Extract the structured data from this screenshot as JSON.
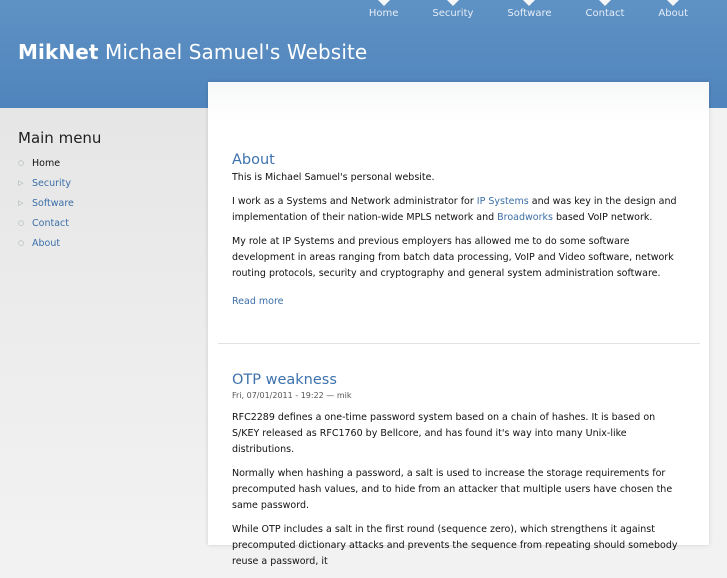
{
  "nav": [
    "Home",
    "Security",
    "Software",
    "Contact",
    "About"
  ],
  "site": {
    "name": "MikNet",
    "tagline": "Michael Samuel's Website"
  },
  "sidebar": {
    "title": "Main menu",
    "items": [
      {
        "label": "Home",
        "active": true
      },
      {
        "label": "Security",
        "active": false
      },
      {
        "label": "Software",
        "active": false
      },
      {
        "label": "Contact",
        "active": false
      },
      {
        "label": "About",
        "active": false
      }
    ]
  },
  "about": {
    "title": "About",
    "p1": "This is Michael Samuel's personal website.",
    "p2_a": "I work as a Systems and Network administrator for ",
    "p2_link1": "IP Systems",
    "p2_b": " and was key in the design and implementation of their nation-wide MPLS network and ",
    "p2_link2": "Broadworks",
    "p2_c": " based VoIP network.",
    "p3": "My role at IP Systems and previous employers has allowed me to do some software development in areas ranging from batch data processing, VoIP and Video software, network routing protocols, security and cryptography and general system administration software.",
    "read_more": "Read more"
  },
  "otp": {
    "title": "OTP weakness",
    "meta": "Fri, 07/01/2011 - 19:22 — mik",
    "p1": "RFC2289 defines a one-time password system based on a chain of hashes. It is based on S/KEY released as RFC1760 by Bellcore, and has found it's way into many Unix-like distributions.",
    "p2": "Normally when hashing a password, a salt is used to increase the storage requirements for precomputed hash values, and to hide from an attacker that multiple users have chosen the same password.",
    "p3": "While OTP includes a salt in the first round (sequence zero), which strengthens it against precomputed dictionary attacks and prevents the sequence from repeating should somebody reuse a password, it"
  }
}
